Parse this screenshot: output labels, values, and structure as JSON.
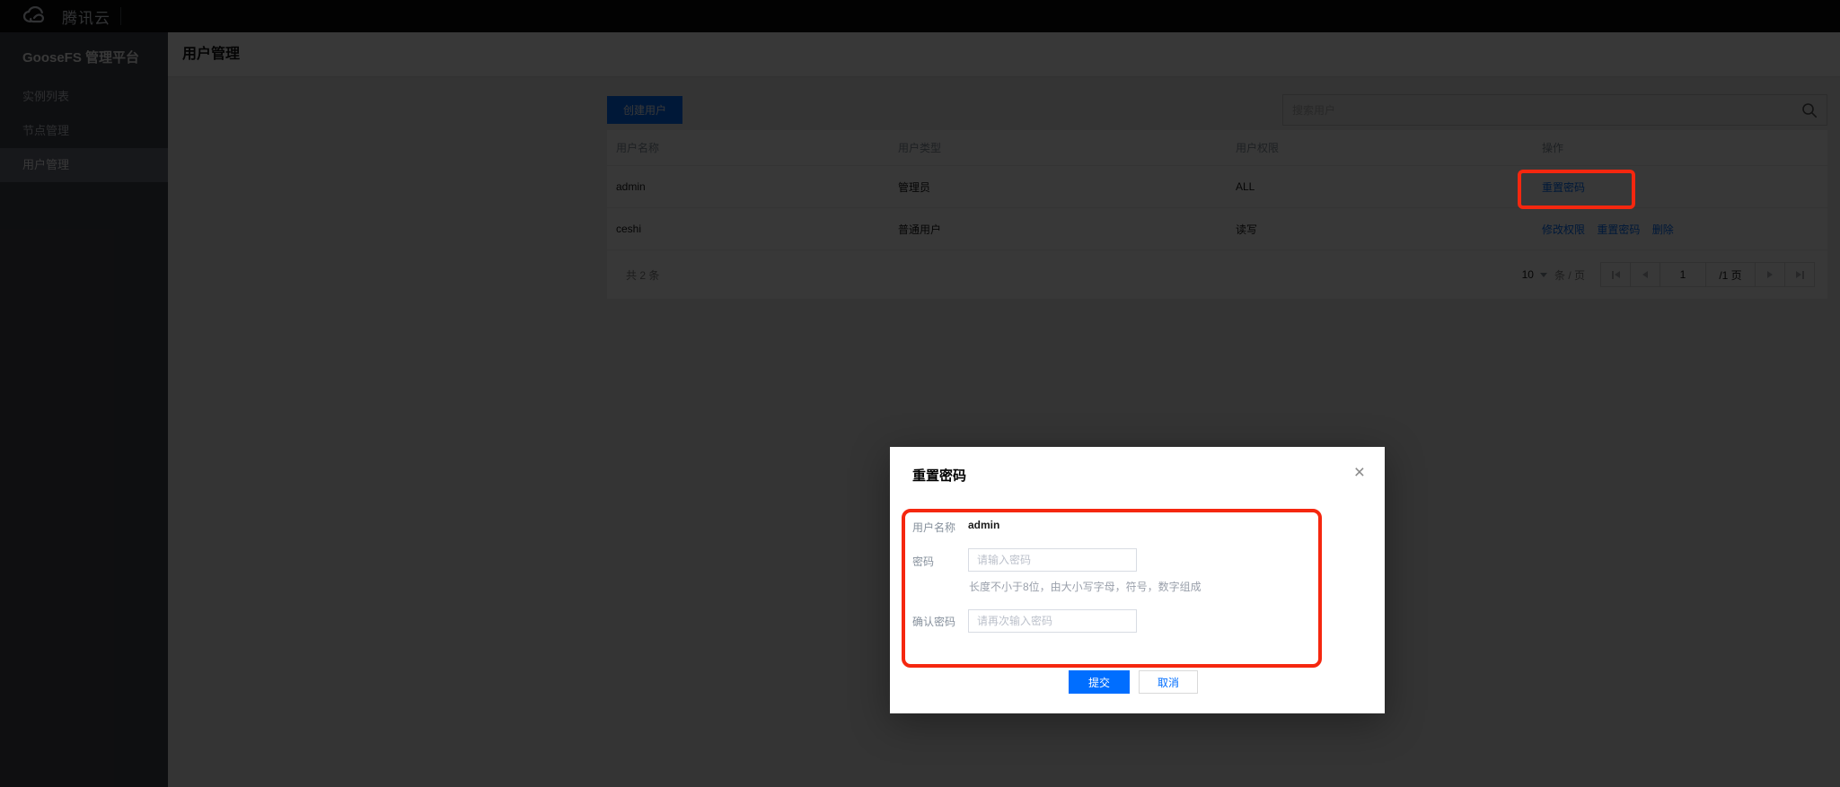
{
  "topbar": {
    "brand": "腾讯云"
  },
  "sidebar": {
    "title": "GooseFS 管理平台",
    "items": [
      {
        "label": "实例列表",
        "active": false
      },
      {
        "label": "节点管理",
        "active": false
      },
      {
        "label": "用户管理",
        "active": true
      }
    ]
  },
  "page": {
    "title": "用户管理"
  },
  "toolbar": {
    "create_button": "创建用户",
    "search_placeholder": "搜索用户"
  },
  "table": {
    "columns": [
      "用户名称",
      "用户类型",
      "用户权限",
      "操作"
    ],
    "rows": [
      {
        "name": "admin",
        "type": "管理员",
        "perm": "ALL",
        "actions": [
          "重置密码"
        ]
      },
      {
        "name": "ceshi",
        "type": "普通用户",
        "perm": "读写",
        "actions": [
          "修改权限",
          "重置密码",
          "删除"
        ]
      }
    ]
  },
  "pagination": {
    "total": "共 2 条",
    "page_size": "10",
    "unit": "条 / 页",
    "page": "1",
    "page_suffix": "/1 页"
  },
  "modal": {
    "title": "重置密码",
    "username_label": "用户名称",
    "username_value": "admin",
    "password_label": "密码",
    "password_placeholder": "请输入密码",
    "password_hint": "长度不小于8位，由大小写字母，符号，数字组成",
    "confirm_label": "确认密码",
    "confirm_placeholder": "请再次输入密码",
    "submit_label": "提交",
    "cancel_label": "取消"
  },
  "colors": {
    "accent": "#006eff",
    "annotation": "#f5270f"
  }
}
